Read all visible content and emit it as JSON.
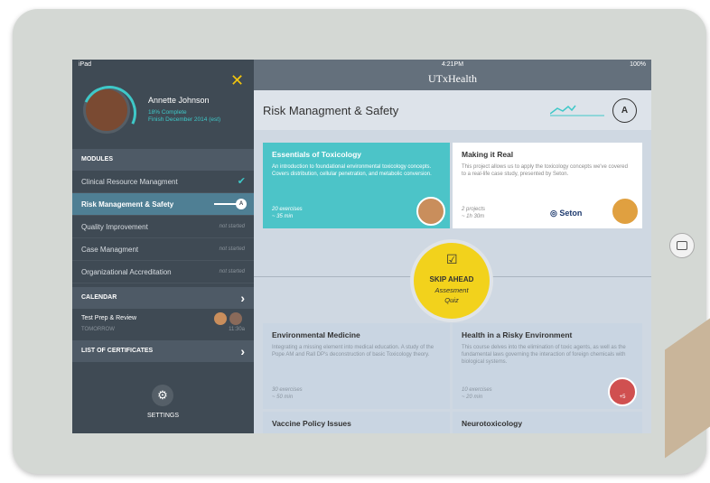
{
  "status": {
    "device": "iPad",
    "time": "4:21PM",
    "battery": "100%"
  },
  "brand": "UTxHealth",
  "profile": {
    "name": "Annette Johnson",
    "complete": "18% Complete",
    "finish": "Finish December 2014 (est)"
  },
  "modules": {
    "header": "MODULES",
    "items": [
      {
        "label": "Clinical Resource Managment",
        "status": ""
      },
      {
        "label": "Risk Management & Safety",
        "status": ""
      },
      {
        "label": "Quality Improvement",
        "status": "not started"
      },
      {
        "label": "Case Managment",
        "status": "not started"
      },
      {
        "label": "Organizational Accreditation",
        "status": "not started"
      }
    ],
    "toggle_letter": "A"
  },
  "calendar": {
    "header": "CALENDAR",
    "item_title": "Test Prep & Review",
    "item_sub": "TOMORROW",
    "item_time": "11:30a"
  },
  "certificates": {
    "header": "LIST OF CERTIFICATES"
  },
  "settings": {
    "label": "SETTINGS"
  },
  "header": {
    "title": "Risk Managment & Safety",
    "avatar_letter": "A"
  },
  "cards": [
    {
      "title": "Essentials of Toxicology",
      "desc": "An introduction to foundational environmental toxicology concepts. Covers distribution, cellular penetration, and metabolic conversion.",
      "meta1": "20 exercises",
      "meta2": "~ 35 min"
    },
    {
      "title": "Making it Real",
      "desc": "This project allows us to apply the toxicology concepts we've covered to a real-life case study, presented by Seton.",
      "meta1": "2 projects",
      "meta2": "~ 1h 30m",
      "logo": "Seton"
    },
    {
      "title": "Environmental Medicine",
      "desc": "Integrating a missing element into medical education. A study of the Pope AM and Rall DP's deconstruction of basic Toxicology theory.",
      "meta1": "30 exercises",
      "meta2": "~ 50 min"
    },
    {
      "title": "Health in a Risky Environment",
      "desc": "This course delves into the elimination of toxic agents, as well as the fundamental laws governing the interaction of foreign chemicals with biological systems.",
      "meta1": "10 exercises",
      "meta2": "~ 20 min",
      "badge": "+5"
    },
    {
      "title": "Vaccine Policy Issues"
    },
    {
      "title": "Neurotoxicology"
    }
  ],
  "skip": {
    "title": "SKIP AHEAD",
    "line1": "Assesment",
    "line2": "Quiz"
  },
  "colors": {
    "teal": "#4cc4c8",
    "sidebar": "#3f4a54",
    "accent_yellow": "#f2d21c"
  }
}
